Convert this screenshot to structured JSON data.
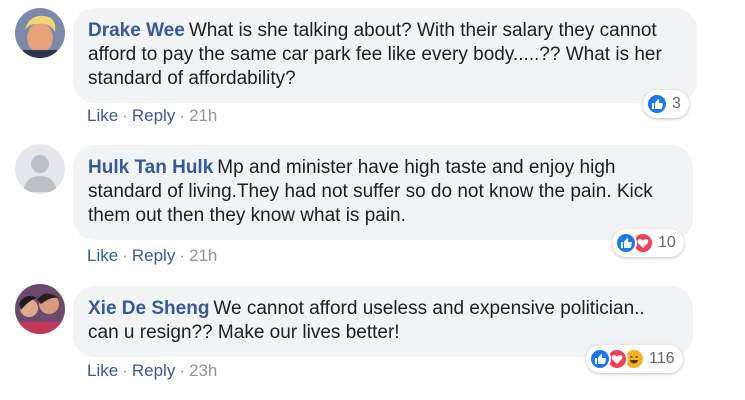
{
  "comments": [
    {
      "author": "Drake Wee",
      "text": "What is she talking about? With their salary they cannot afford to pay the same car park fee like every body.....?? What is her standard of affordability?",
      "actions": {
        "like": "Like",
        "reply": "Reply",
        "time": "21h"
      },
      "reactions": {
        "types": [
          "like"
        ],
        "count": "3"
      }
    },
    {
      "author": "Hulk Tan Hulk",
      "text": "Mp and minister have high taste and enjoy high standard of living.They had not suffer so do not know the pain. Kick them out then they know what is pain.",
      "actions": {
        "like": "Like",
        "reply": "Reply",
        "time": "21h"
      },
      "reactions": {
        "types": [
          "like",
          "love"
        ],
        "count": "10"
      }
    },
    {
      "author": "Xie De Sheng",
      "text": "We cannot afford useless and expensive politician.. can u resign?? Make our lives better!",
      "actions": {
        "like": "Like",
        "reply": "Reply",
        "time": "23h"
      },
      "reactions": {
        "types": [
          "like",
          "love",
          "haha"
        ],
        "count": "116"
      }
    }
  ],
  "colors": {
    "link": "#385898",
    "meta": "#90949c",
    "bubble": "#f2f3f5",
    "like": "#1877f2",
    "love": "#f33e58",
    "haha": "#f7b125"
  },
  "separator": "·"
}
